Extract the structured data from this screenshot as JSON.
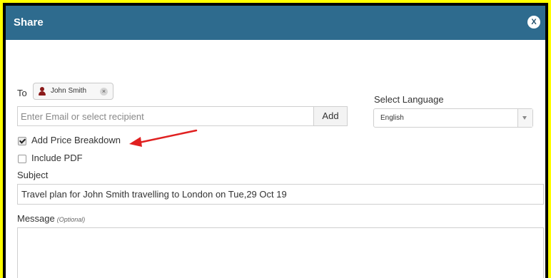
{
  "dialog": {
    "title": "Share",
    "close_label": "X",
    "accent_color": "#2e6b8e"
  },
  "to": {
    "label": "To",
    "recipients": [
      {
        "name": "John Smith",
        "icon": "person-icon"
      }
    ]
  },
  "recipient_input": {
    "value": "",
    "placeholder": "Enter Email or select recipient"
  },
  "add_button": {
    "label": "Add"
  },
  "language": {
    "label": "Select Language",
    "selected": "English"
  },
  "options": {
    "price_breakdown": {
      "label": "Add Price Breakdown",
      "checked": true
    },
    "include_pdf": {
      "label": "Include PDF",
      "checked": false
    }
  },
  "subject": {
    "label": "Subject",
    "value": "Travel plan for John Smith travelling to London on Tue,29 Oct 19"
  },
  "message": {
    "label": "Message",
    "optional_label": "(Optional)",
    "value": ""
  }
}
